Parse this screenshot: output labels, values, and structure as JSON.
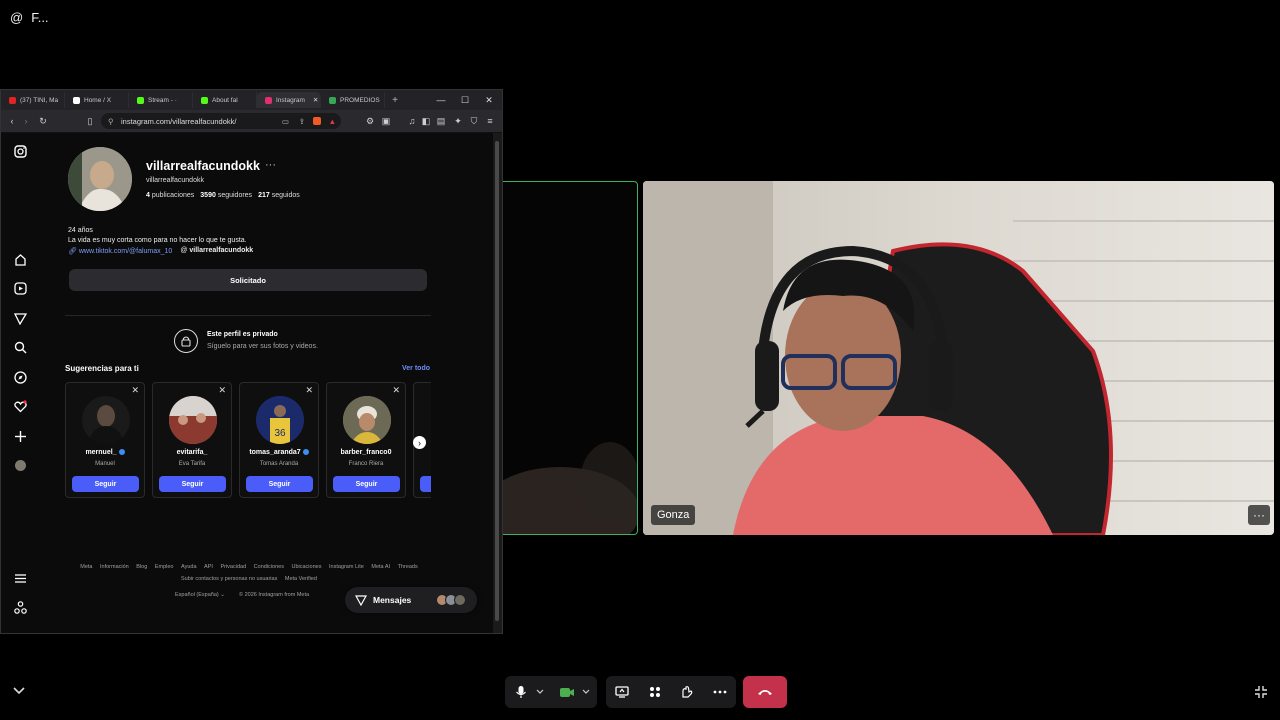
{
  "call": {
    "title_icon": "@",
    "title": "F...",
    "participant_name": "Gonza",
    "tile_more": "···"
  },
  "browser": {
    "tabs": [
      {
        "label": "(37) TINI, Ma",
        "icon": "youtube-icon",
        "color": "#e02424"
      },
      {
        "label": "Home / X",
        "icon": "x-icon",
        "color": "#ffffff"
      },
      {
        "label": "Stream - ·",
        "icon": "kick-icon",
        "color": "#53fc18"
      },
      {
        "label": "About fal",
        "icon": "kick-icon",
        "color": "#53fc18"
      },
      {
        "label": "Instagram",
        "icon": "instagram-icon",
        "color": "#e1306c",
        "active": true
      },
      {
        "label": "PROMEDIOS",
        "icon": "sheet-icon",
        "color": "#34a853"
      }
    ],
    "tab_add": "+",
    "window_controls": {
      "minimize": "—",
      "maximize": "☐",
      "close": "✕"
    },
    "url": "instagram.com/villarrealfacundokk/"
  },
  "profile": {
    "username": "villarrealfacundokk",
    "more": "···",
    "full_name": "villarrealfacundokk",
    "posts_count": "4",
    "posts_label": "publicaciones",
    "followers_count": "3590",
    "followers_label": "seguidores",
    "following_count": "217",
    "following_label": "seguidos",
    "bio_line1": "24 años",
    "bio_line2": "La vida es muy corta como para no hacer lo que te gusta.",
    "link_tiktok": "www.tiktok.com/@falumax_10",
    "link_threads": "villarrealfacundokk",
    "request_button": "Solicitado",
    "private_title": "Este perfil es privado",
    "private_subtitle": "Síguelo para ver sus fotos y videos."
  },
  "suggestions": {
    "title": "Sugerencias para ti",
    "see_all": "Ver todo",
    "follow_label": "Seguir",
    "items": [
      {
        "username": "mernuel_",
        "name": "Manuel",
        "verified": true,
        "avatar_color": "#1a1a1a"
      },
      {
        "username": "evitarifa_",
        "name": "Eva Tarifa",
        "verified": false,
        "avatar_color": "#b9a3a0"
      },
      {
        "username": "tomas_aranda7",
        "name": "Tomas Aranda",
        "verified": true,
        "avatar_color": "#1b2a6b"
      },
      {
        "username": "barber_franco0",
        "name": "Franco Riera",
        "verified": false,
        "avatar_color": "#9a8f6a"
      }
    ]
  },
  "footer": {
    "links": [
      "Meta",
      "Información",
      "Blog",
      "Empleo",
      "Ayuda",
      "API",
      "Privacidad",
      "Condiciones",
      "Ubicaciones",
      "Instagram Lite",
      "Meta AI",
      "Threads",
      "Subir contactos y personas no usuarias",
      "Meta Verified"
    ],
    "language": "Español (España)",
    "copyright": "© 2026 Instagram from Meta"
  },
  "messages": {
    "label": "Mensajes"
  },
  "colors": {
    "accent_blue": "#4a5df9",
    "end_call_red": "#c4314b",
    "active_speaker_green": "#3fb160"
  }
}
